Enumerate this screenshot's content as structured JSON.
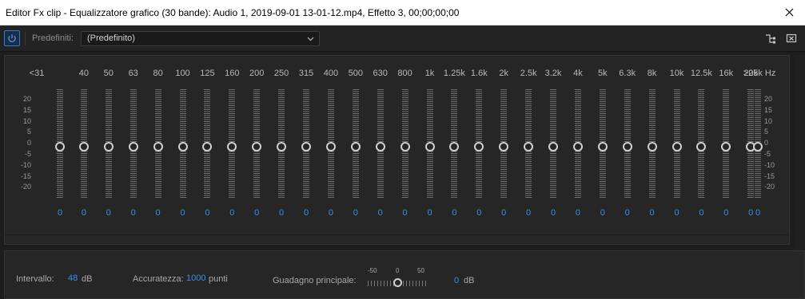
{
  "window": {
    "title": "Editor Fx clip - Equalizzatore grafico (30 bande): Audio 1, 2019-09-01 13-01-12.mp4, Effetto 3, 00;00;00;00"
  },
  "toolbar": {
    "preset_label": "Predefiniti:",
    "preset_value": "(Predefinito)"
  },
  "eq": {
    "bands": [
      {
        "freq": "<31",
        "gain": "0"
      },
      {
        "freq": "40",
        "gain": "0"
      },
      {
        "freq": "50",
        "gain": "0"
      },
      {
        "freq": "63",
        "gain": "0"
      },
      {
        "freq": "80",
        "gain": "0"
      },
      {
        "freq": "100",
        "gain": "0"
      },
      {
        "freq": "125",
        "gain": "0"
      },
      {
        "freq": "160",
        "gain": "0"
      },
      {
        "freq": "200",
        "gain": "0"
      },
      {
        "freq": "250",
        "gain": "0"
      },
      {
        "freq": "315",
        "gain": "0"
      },
      {
        "freq": "400",
        "gain": "0"
      },
      {
        "freq": "500",
        "gain": "0"
      },
      {
        "freq": "630",
        "gain": "0"
      },
      {
        "freq": "800",
        "gain": "0"
      },
      {
        "freq": "1k",
        "gain": "0"
      },
      {
        "freq": "1.25k",
        "gain": "0"
      },
      {
        "freq": "1.6k",
        "gain": "0"
      },
      {
        "freq": "2k",
        "gain": "0"
      },
      {
        "freq": "2.5k",
        "gain": "0"
      },
      {
        "freq": "3.2k",
        "gain": "0"
      },
      {
        "freq": "4k",
        "gain": "0"
      },
      {
        "freq": "5k",
        "gain": "0"
      },
      {
        "freq": "6.3k",
        "gain": "0"
      },
      {
        "freq": "8k",
        "gain": "0"
      },
      {
        "freq": "10k",
        "gain": "0"
      },
      {
        "freq": "12.5k",
        "gain": "0"
      },
      {
        "freq": "16k",
        "gain": "0"
      },
      {
        "freq": "20k",
        "gain": "0"
      },
      {
        "freq": ">25k Hz",
        "gain": "0"
      }
    ],
    "scale": [
      "20",
      "15",
      "10",
      "5",
      "0",
      "-5",
      "-10",
      "-15",
      "-20"
    ]
  },
  "bottom": {
    "range_label": "Intervallo:",
    "range_value": "48",
    "range_unit": "dB",
    "accuracy_label": "Accuratezza:",
    "accuracy_value": "1000",
    "accuracy_unit": "punti",
    "gain_label": "Guadagno principale:",
    "gain_ticks": [
      "-50",
      "0",
      "50"
    ],
    "gain_value": "0",
    "gain_unit": "dB"
  }
}
